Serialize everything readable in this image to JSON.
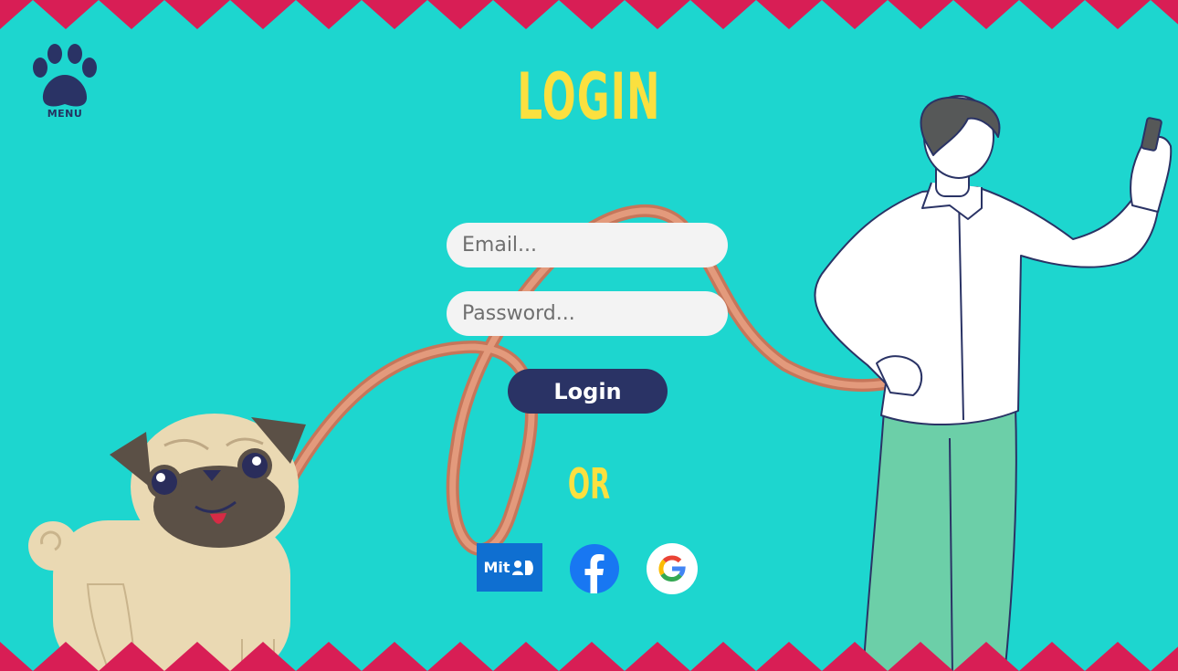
{
  "page": {
    "title": "LOGIN",
    "or_label": "OR"
  },
  "menu": {
    "label": "MENU",
    "icon": "paw-icon"
  },
  "form": {
    "email_placeholder": "Email...",
    "password_placeholder": "Password...",
    "email_value": "",
    "password_value": "",
    "submit_label": "Login"
  },
  "social_logins": [
    {
      "provider": "MitID",
      "label": "Mit",
      "icon": "mitid-icon"
    },
    {
      "provider": "Facebook",
      "icon": "facebook-icon"
    },
    {
      "provider": "Google",
      "icon": "google-icon"
    }
  ],
  "colors": {
    "background": "#1dd6cf",
    "zigzag": "#d81e55",
    "title": "#fbe03f",
    "button": "#2a3365",
    "input": "#f3f3f3",
    "mitid": "#0f6fd1",
    "facebook": "#1877f2"
  }
}
